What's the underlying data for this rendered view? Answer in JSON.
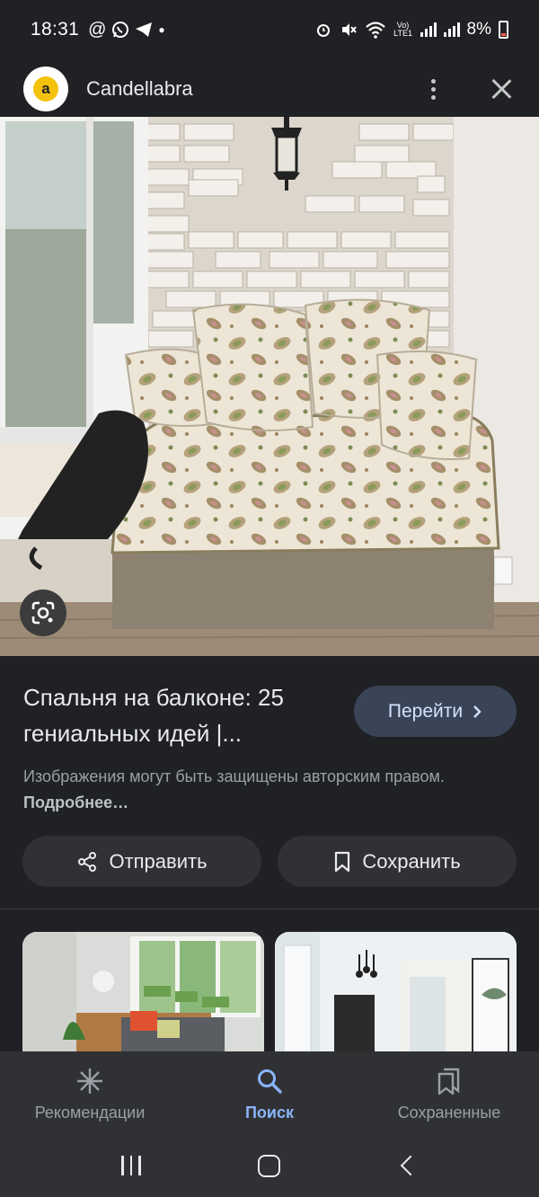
{
  "status_bar": {
    "time": "18:31",
    "left_icons": [
      "at-sign-icon",
      "whatsapp-icon",
      "telegram-icon",
      "dot-icon"
    ],
    "network_label": "Vo) LTE1",
    "battery": "8%"
  },
  "header": {
    "site_name": "Candellabra",
    "logo_letter": "a"
  },
  "result": {
    "title": "Спальня на балконе: 25 гениальных идей |...",
    "visit_label": "Перейти",
    "copyright_text": "Изображения могут быть защищены авторским правом.",
    "more_link": "Подробнее…",
    "share_label": "Отправить",
    "save_label": "Сохранить"
  },
  "bottom_nav": {
    "items": [
      {
        "label": "Рекомендации",
        "icon": "sparkle-icon",
        "active": false
      },
      {
        "label": "Поиск",
        "icon": "search-icon",
        "active": true
      },
      {
        "label": "Сохраненные",
        "icon": "saved-collections-icon",
        "active": false
      }
    ]
  },
  "colors": {
    "background": "#202124",
    "accent": "#8ab4f8",
    "visit_button": "#394457",
    "surface": "#303134"
  }
}
